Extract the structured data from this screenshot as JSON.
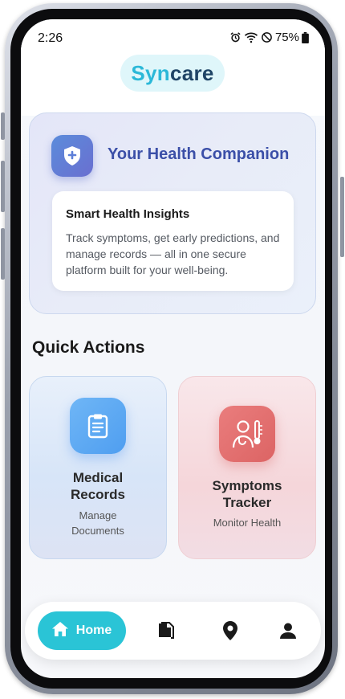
{
  "status_bar": {
    "time": "2:26",
    "battery": "75%"
  },
  "header": {
    "logo_part1": "Syn",
    "logo_part2": "care"
  },
  "hero": {
    "title": "Your Health Companion",
    "card_title": "Smart Health Insights",
    "card_body": "Track symptoms, get early predictions, and manage records — all in one secure platform built for your well-being."
  },
  "quick_actions": {
    "title": "Quick Actions",
    "records": {
      "title_line1": "Medical",
      "title_line2": "Records",
      "sub_line1": "Manage",
      "sub_line2": "Documents"
    },
    "symptoms": {
      "title_line1": "Symptoms",
      "title_line2": "Tracker",
      "sub": "Monitor Health"
    }
  },
  "nav": {
    "home_label": "Home"
  },
  "colors": {
    "accent": "#2ac4d6",
    "brand_dark": "#1f4466",
    "hero_title": "#3b4fa8",
    "records_icon": "#4f9ef0",
    "symptoms_icon": "#dc6464"
  },
  "icons": [
    "alarm-icon",
    "wifi-icon",
    "do-not-disturb-icon",
    "battery-icon",
    "shield-plus-icon",
    "clipboard-icon",
    "doctor-thermometer-icon",
    "home-icon",
    "documents-icon",
    "location-pin-icon",
    "person-icon"
  ]
}
